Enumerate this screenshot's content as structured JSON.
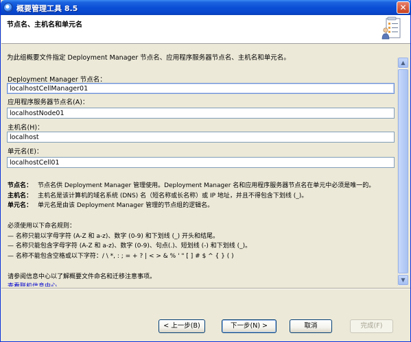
{
  "window": {
    "title": "概要管理工具 8.5",
    "close_symbol": "✕"
  },
  "banner": {
    "title": "节点名、主机名和单元名",
    "icon": "checklist-person-icon"
  },
  "description": "为此组概要文件指定 Deployment Manager 节点名、应用程序服务器节点名、主机名和单元名。",
  "fields": {
    "dm_node": {
      "label": "Deployment Manager 节点名：",
      "value": "localhostCellManager01"
    },
    "app_node": {
      "label": "应用程序服务器节点名(A)：",
      "value": "localhostNode01"
    },
    "host": {
      "label": "主机名(H)：",
      "value": "localhost"
    },
    "cell": {
      "label": "单元名(E)：",
      "value": "localhostCell01"
    }
  },
  "definitions": [
    {
      "term": "节点名：",
      "text": "节点名供 Deployment Manager 管理使用。Deployment Manager 名和应用程序服务器节点名在单元中必须是唯一的。"
    },
    {
      "term": "主机名：",
      "text": "主机名是该计算机的域名系统 (DNS) 名（短名称或长名称）或 IP 地址，并且不得包含下划线 (_)。"
    },
    {
      "term": "单元名：",
      "text": "单元名是由该 Deployment Manager 管理的节点组的逻辑名。"
    }
  ],
  "rules": {
    "heading": "必须使用以下命名规则：",
    "items": [
      "— 名称只能以字母字符 (A-Z 和 a-z)、数字 (0-9) 和下划线 (_) 开头和结尾。",
      "— 名称只能包含字母字符 (A-Z 和 a-z)、数字 (0-9)、句点(.)、短划线 (-) 和下划线 (_)。",
      "— 名称不能包含空格或以下字符：/ \\ *, : ; = + ? | < > & % ' \" [ ] # $ ^ { } ( )"
    ]
  },
  "more_info": "请参阅信息中心以了解概要文件命名和迁移注意事项。",
  "more_link": "查看联机信息中心",
  "buttons": {
    "back": "< 上一步(B)",
    "next": "下一步(N) >",
    "cancel": "取消",
    "finish": "完成(F)"
  },
  "scrollbar": {
    "up": "▲",
    "down": "▼"
  }
}
